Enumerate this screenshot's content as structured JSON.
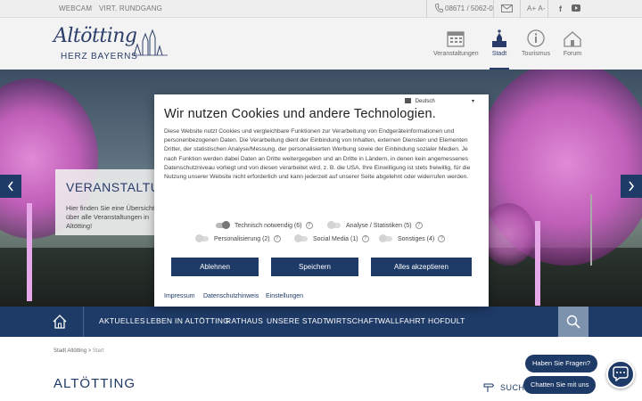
{
  "topbar": {
    "webcam": "WEBCAM",
    "tour": "VIRT. RUNDGANG",
    "phone": "08671 / 5062-0",
    "font_size": "A+ A-"
  },
  "header": {
    "logo_script": "Altötting",
    "logo_sub": "HERZ BAYERNS",
    "nav": [
      {
        "label": "Veranstaltungen",
        "icon": "calendar-icon"
      },
      {
        "label": "Stadt",
        "icon": "church-icon"
      },
      {
        "label": "Tourismus",
        "icon": "info-icon"
      },
      {
        "label": "Forum",
        "icon": "forum-icon"
      }
    ]
  },
  "hero": {
    "event_title": "VERANSTALTUNGEN",
    "event_desc": "Hier finden Sie eine Übersicht über alle Veranstaltungen in Altötting!"
  },
  "mainnav": {
    "items": [
      "AKTUELLES",
      "LEBEN IN ALTÖTTING",
      "RATHAUS",
      "UNSERE STADT",
      "WIRTSCHAFT",
      "WALLFAHRT",
      "HOFDULT"
    ]
  },
  "breadcrumb": {
    "parent": "Stadt Altötting",
    "sep": ">",
    "current": "Start"
  },
  "page": {
    "title": "ALTÖTTING",
    "search_label": "SUCHE"
  },
  "chat": {
    "question": "Haben Sie Fragen?",
    "cta": "Chatten Sie mit uns"
  },
  "cookie": {
    "language": "Deutsch",
    "title": "Wir nutzen Cookies und andere Technologien.",
    "body": "Diese Website nutzt Cookies und vergleichbare Funktionen zur Verarbeitung von Endgeräteinformationen und personenbezogenen Daten. Die Verarbeitung dient der Einbindung von Inhalten, externen Diensten und Elementen Dritter, der statistischen Analyse/Messung, der personalisierten Werbung sowie der Einbindung sozialer Medien. Je nach Funktion werden dabei Daten an Dritte weitergegeben und an Dritte in Ländern, in denen kein angemessenes Datenschutzniveau vorliegt und von diesen verarbeitet wird, z. B. die USA. Ihre Einwilligung ist stets freiwillig, für die Nutzung unserer Website nicht erforderlich und kann jederzeit auf unserer Seite abgelehnt oder widerrufen werden.",
    "toggles": [
      {
        "label": "Technisch notwendig (6)",
        "on": true
      },
      {
        "label": "Analyse / Statistiken (5)",
        "on": false
      },
      {
        "label": "Personalisierung (2)",
        "on": false
      },
      {
        "label": "Social Media (1)",
        "on": false
      },
      {
        "label": "Sonstiges (4)",
        "on": false
      }
    ],
    "reject": "Ablehnen",
    "save": "Speichern",
    "accept": "Alles akzeptieren",
    "links": [
      "Impressum",
      "Datenschutzhinweis",
      "Einstellungen"
    ]
  },
  "colors": {
    "brand_navy": "#1e3a66",
    "blossom_pink": "#c05fb8"
  }
}
